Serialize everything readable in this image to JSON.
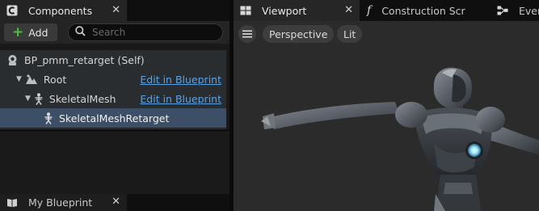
{
  "components_panel": {
    "tab_label": "Components",
    "add_label": "Add",
    "search_placeholder": "Search",
    "tree": [
      {
        "label": "BP_pmm_retarget (Self)",
        "icon": "blueprint-self-icon"
      },
      {
        "label": "Root",
        "icon": "root-scene-icon",
        "link": "Edit in Blueprint"
      },
      {
        "label": "SkeletalMesh",
        "icon": "skeletal-mesh-icon",
        "link": "Edit in Blueprint"
      },
      {
        "label": "SkeletalMeshRetarget",
        "icon": "skeletal-mesh-icon",
        "selected": true
      }
    ]
  },
  "my_blueprint_panel": {
    "tab_label": "My Blueprint"
  },
  "editor_tabs": {
    "viewport": "Viewport",
    "construction_script": "Construction Scr",
    "event_graph": "Even"
  },
  "viewport": {
    "view_mode": "Perspective",
    "lighting": "Lit"
  },
  "colors": {
    "accent_link": "#5aa2e6",
    "selection": "#3c4f66",
    "add_plus": "#4fbf3f",
    "chest_light": "#9fe8ff"
  }
}
